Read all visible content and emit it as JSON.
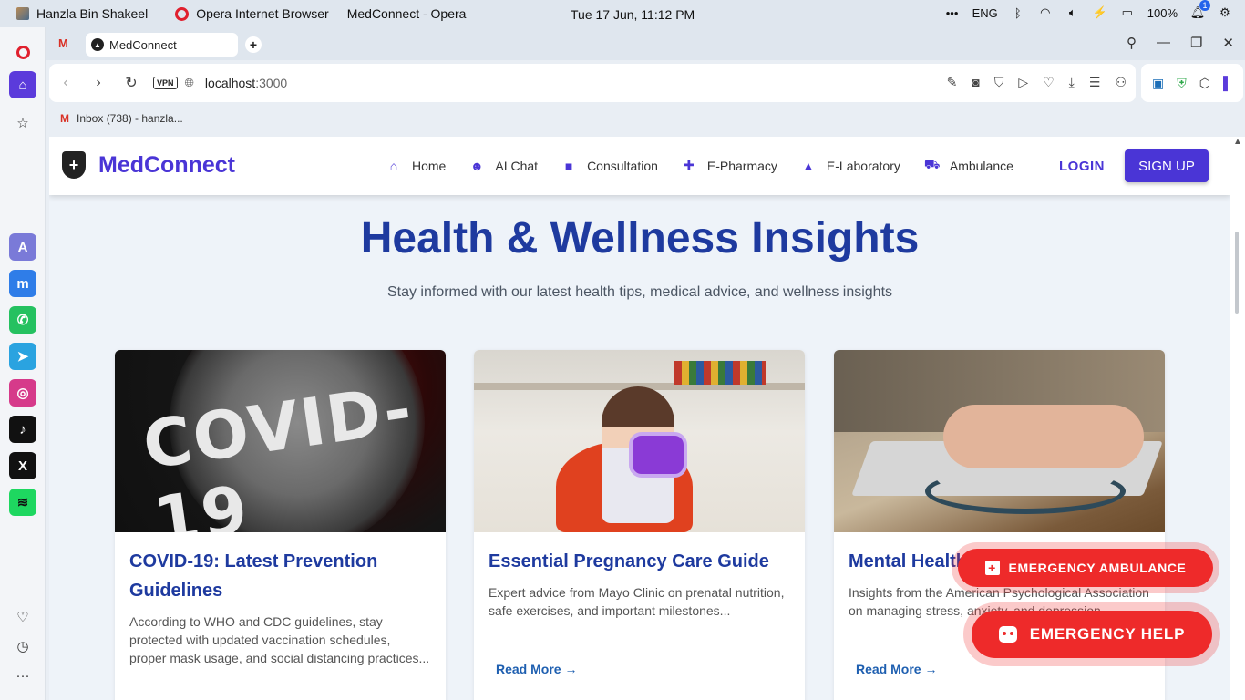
{
  "os": {
    "user": "Hanzla Bin Shakeel",
    "app": "Opera Internet Browser",
    "window_title": "MedConnect - Opera",
    "clock": "Tue 17 Jun, 11:12 PM",
    "lang": "ENG",
    "battery": "100%",
    "notif_count": "1"
  },
  "browser": {
    "tab_title": "MedConnect",
    "vpn": "VPN",
    "url_host": "localhost",
    "url_port": ":3000",
    "bookmark": "Inbox (738) - hanzla..."
  },
  "site": {
    "brand": "MedConnect",
    "nav": [
      "Home",
      "AI Chat",
      "Consultation",
      "E-Pharmacy",
      "E-Laboratory",
      "Ambulance"
    ],
    "login": "LOGIN",
    "signup": "SIGN UP",
    "hero_title": "Health & Wellness Insights",
    "hero_subtitle": "Stay informed with our latest health tips, medical advice, and wellness insights",
    "image1_text": "COVID-19",
    "cards": [
      {
        "title": "COVID-19: Latest Prevention Guidelines",
        "text": "According to WHO and CDC guidelines, stay protected with updated vaccination schedules, proper mask usage, and social distancing practices..."
      },
      {
        "title": "Essential Pregnancy Care Guide",
        "text": "Expert advice from Mayo Clinic on prenatal nutrition, safe exercises, and important milestones...",
        "read_more": "Read More →"
      },
      {
        "title": "Mental Health",
        "text": "Insights from the American Psychological Association on managing stress, anxiety, and depression...",
        "read_more": "Read More →"
      }
    ],
    "emergency_ambulance": "EMERGENCY AMBULANCE",
    "emergency_help": "EMERGENCY HELP"
  },
  "colors": {
    "brand": "#4a35d6",
    "heading": "#1e3a9f",
    "emergency": "#ee2a2a"
  }
}
